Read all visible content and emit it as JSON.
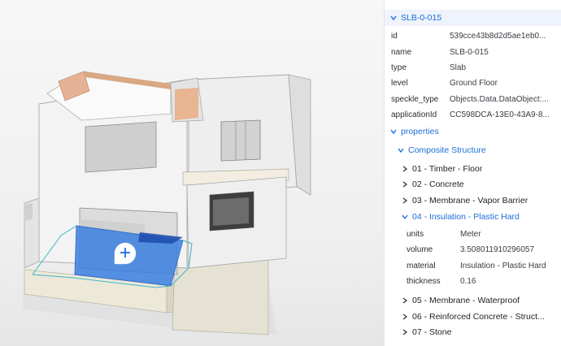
{
  "object": {
    "title": "SLB-0-015",
    "fields": [
      {
        "key": "id",
        "value": "539cce43b8d2d5ae1eb0..."
      },
      {
        "key": "name",
        "value": "SLB-0-015"
      },
      {
        "key": "type",
        "value": "Slab"
      },
      {
        "key": "level",
        "value": "Ground Floor"
      },
      {
        "key": "speckle_type",
        "value": "Objects.Data.DataObject:..."
      },
      {
        "key": "applicationId",
        "value": "CC598DCA-13E0-43A9-8..."
      }
    ]
  },
  "properties": {
    "label": "properties",
    "composite": {
      "label": "Composite Structure",
      "groups": [
        {
          "label": "01 - Timber - Floor"
        },
        {
          "label": "02 - Concrete"
        },
        {
          "label": "03 - Membrane - Vapor Barrier"
        },
        {
          "label": "04 - Insulation - Plastic Hard"
        },
        {
          "label": "05 - Membrane - Waterproof"
        },
        {
          "label": "06 - Reinforced Concrete - Struct..."
        },
        {
          "label": "07 - Stone"
        }
      ],
      "open_group_fields": [
        {
          "key": "units",
          "value": "Meter"
        },
        {
          "key": "volume",
          "value": "3.508011910296057"
        },
        {
          "key": "material",
          "value": "Insulation - Plastic Hard"
        },
        {
          "key": "thickness",
          "value": "0.16"
        }
      ]
    }
  },
  "viewer": {
    "add_icon": "plus-comment-icon"
  },
  "colors": {
    "accent": "#1a6ed8",
    "selection": "#3b7fe0",
    "panel_bg": "#ffffff"
  }
}
